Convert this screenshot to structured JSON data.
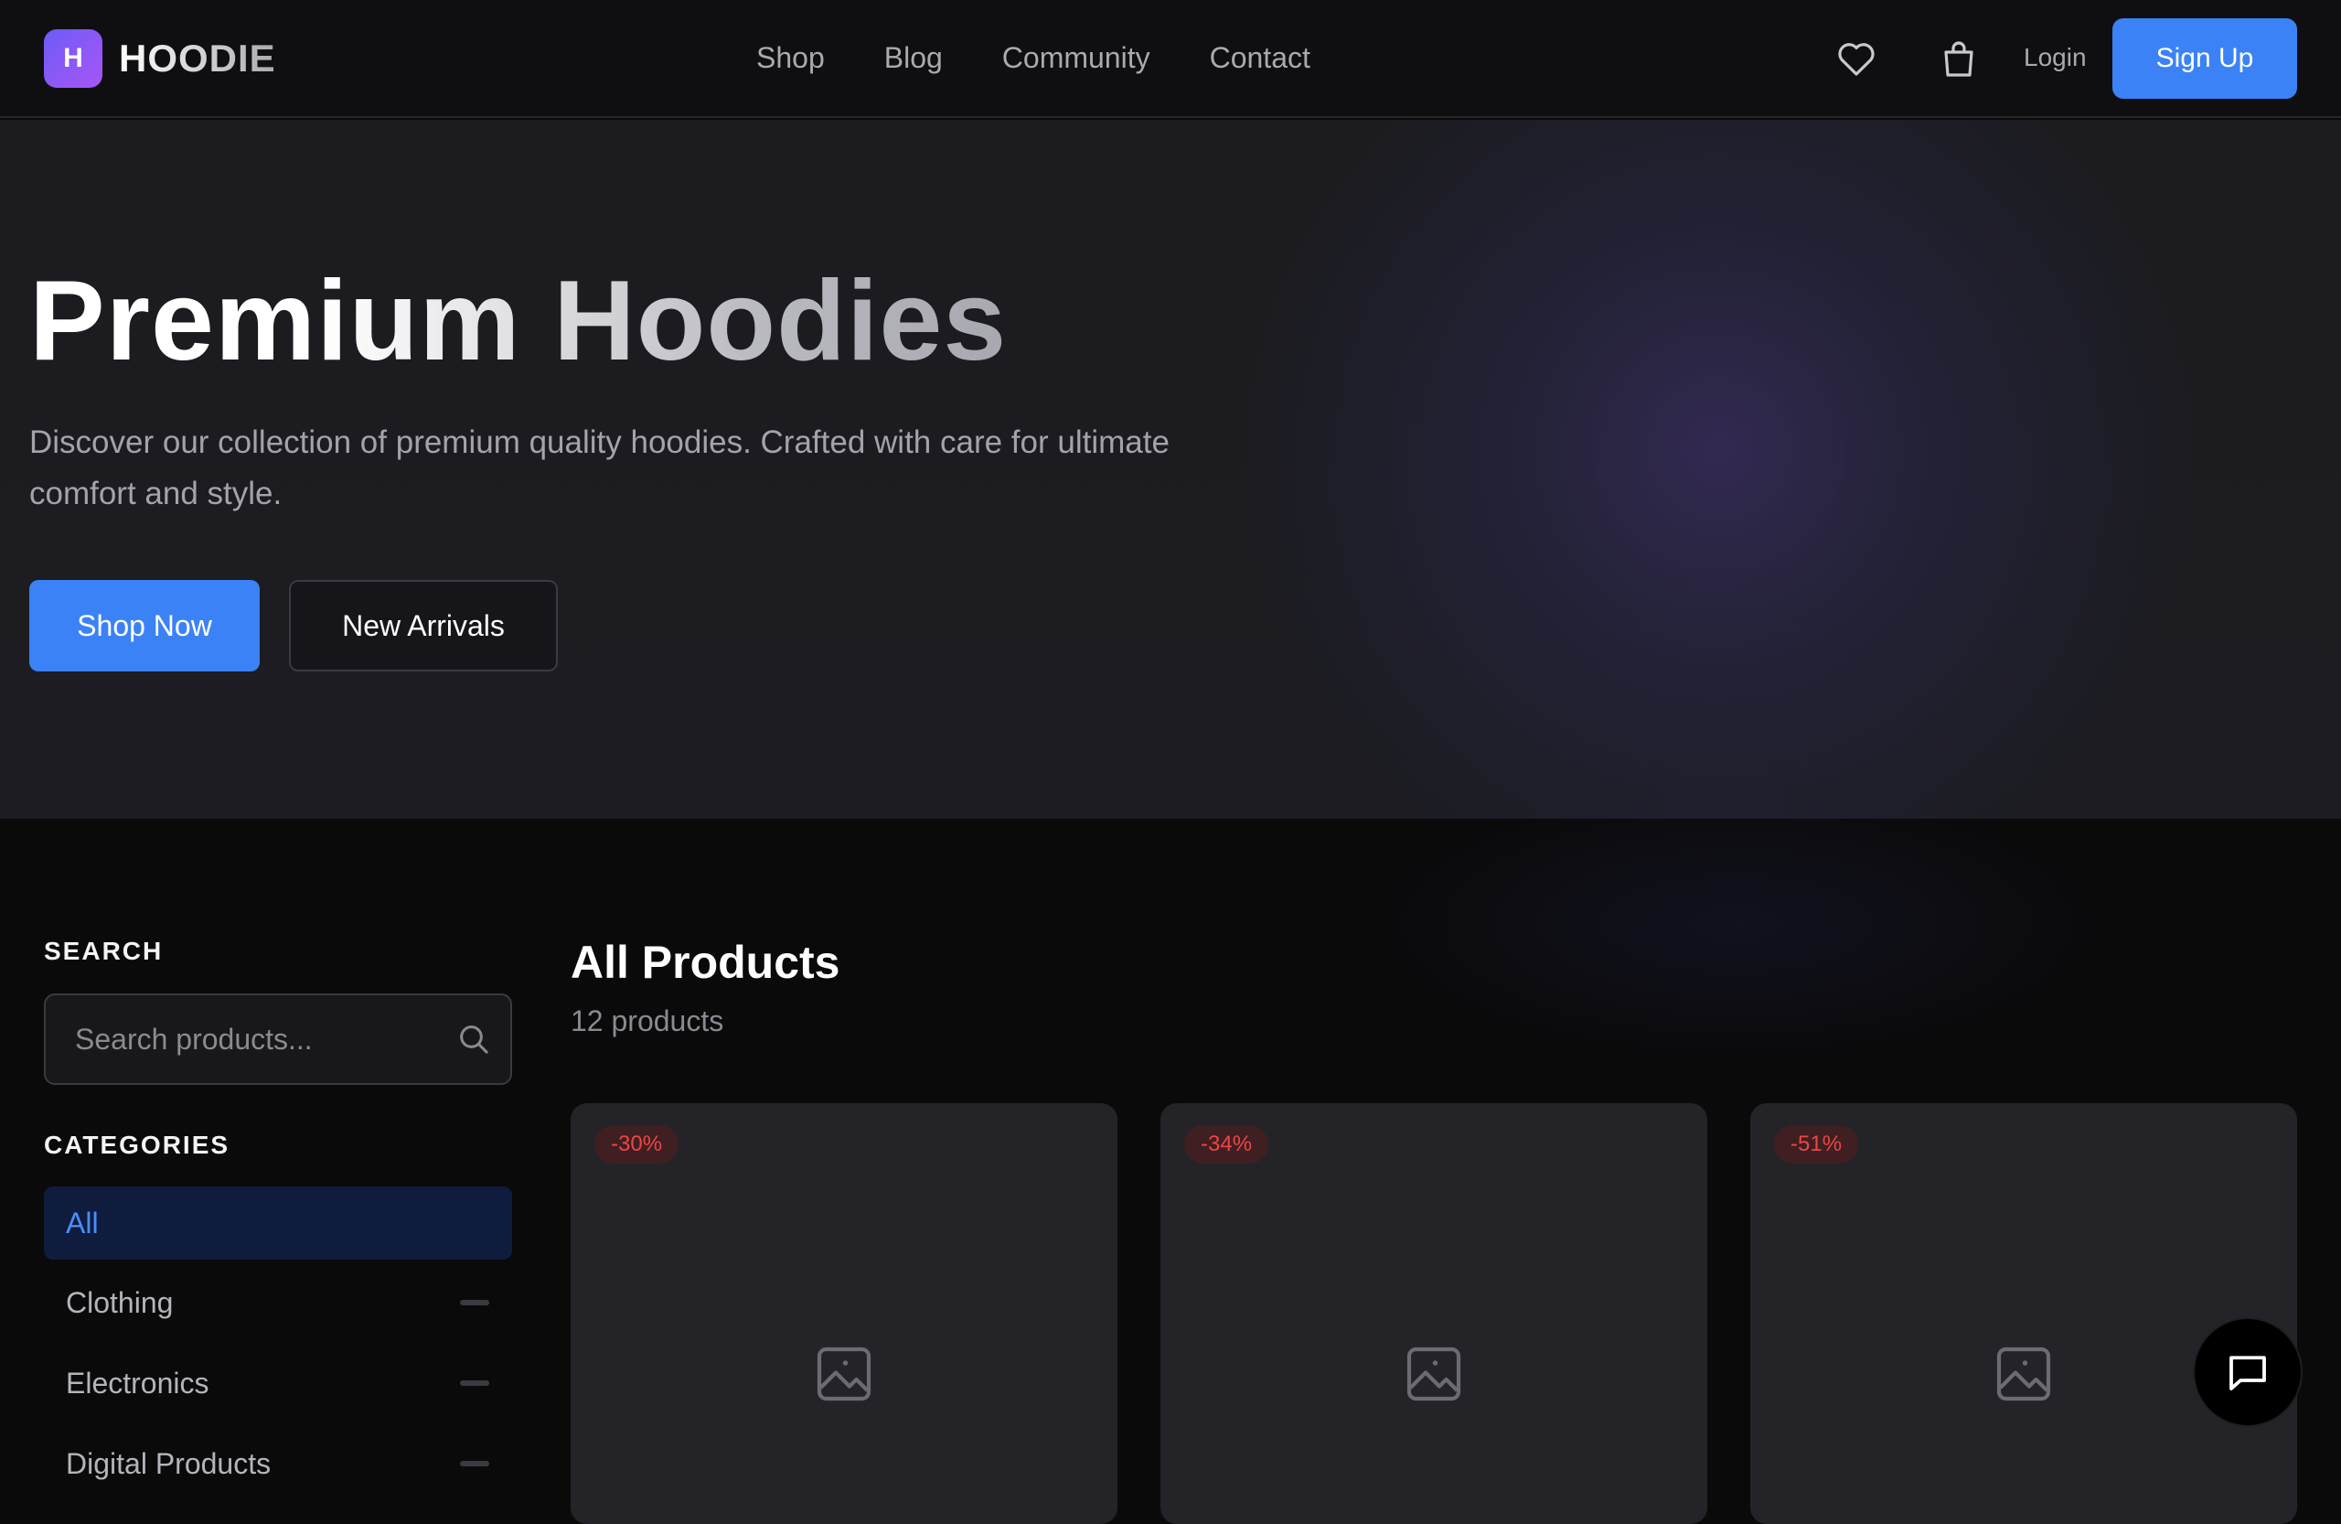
{
  "brand": {
    "logo_letter": "H",
    "name": "HOODIE",
    "gradient": [
      "#6d5cf6",
      "#a855f7"
    ]
  },
  "nav": {
    "items": [
      "Shop",
      "Blog",
      "Community",
      "Contact"
    ]
  },
  "header": {
    "icons": [
      "heart-icon",
      "shopping-bag-icon"
    ],
    "login_label": "Login",
    "signup_label": "Sign Up"
  },
  "hero": {
    "title": "Premium Hoodies",
    "subtitle": "Discover our collection of premium quality hoodies. Crafted with care for ultimate comfort and style.",
    "primary_cta": "Shop Now",
    "secondary_cta": "New Arrivals"
  },
  "sidebar": {
    "search_heading": "SEARCH",
    "search_placeholder": "Search products...",
    "categories_heading": "CATEGORIES",
    "categories": [
      {
        "label": "All",
        "active": true
      },
      {
        "label": "Clothing",
        "active": false
      },
      {
        "label": "Electronics",
        "active": false
      },
      {
        "label": "Digital Products",
        "active": false
      }
    ]
  },
  "main": {
    "title": "All Products",
    "count_label": "12 products",
    "products": [
      {
        "discount": "-30%"
      },
      {
        "discount": "-34%"
      },
      {
        "discount": "-51%"
      }
    ]
  },
  "colors": {
    "accent": "#3b82f6",
    "background": "#0a0a0b",
    "discount": "#ef4444",
    "active_category": "#4a8dff"
  },
  "chat": {
    "icon": "chat-bubble-icon"
  }
}
